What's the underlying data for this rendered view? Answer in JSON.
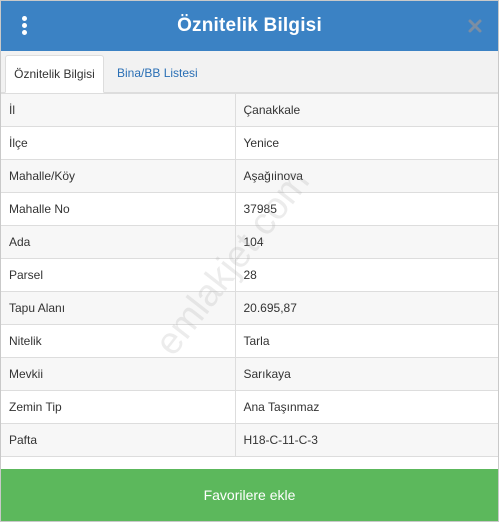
{
  "header": {
    "title": "Öznitelik Bilgisi",
    "menu_icon": "kebab-menu-icon",
    "close_icon": "close-icon",
    "color": "#3b82c4"
  },
  "tabs": [
    {
      "label": "Öznitelik Bilgisi",
      "active": true
    },
    {
      "label": "Bina/BB Listesi",
      "active": false
    }
  ],
  "attributes": [
    {
      "key": "İl",
      "value": "Çanakkale"
    },
    {
      "key": "İlçe",
      "value": "Yenice"
    },
    {
      "key": "Mahalle/Köy",
      "value": "Aşağıinova"
    },
    {
      "key": "Mahalle No",
      "value": "37985"
    },
    {
      "key": "Ada",
      "value": "104"
    },
    {
      "key": "Parsel",
      "value": "28"
    },
    {
      "key": "Tapu Alanı",
      "value": "20.695,87"
    },
    {
      "key": "Nitelik",
      "value": "Tarla"
    },
    {
      "key": "Mevkii",
      "value": "Sarıkaya"
    },
    {
      "key": "Zemin Tip",
      "value": "Ana Taşınmaz"
    },
    {
      "key": "Pafta",
      "value": "H18-C-11-C-3"
    }
  ],
  "footer": {
    "button_label": "Favorilere ekle",
    "color": "#5cb85c"
  },
  "watermark": "emlakjet.com"
}
